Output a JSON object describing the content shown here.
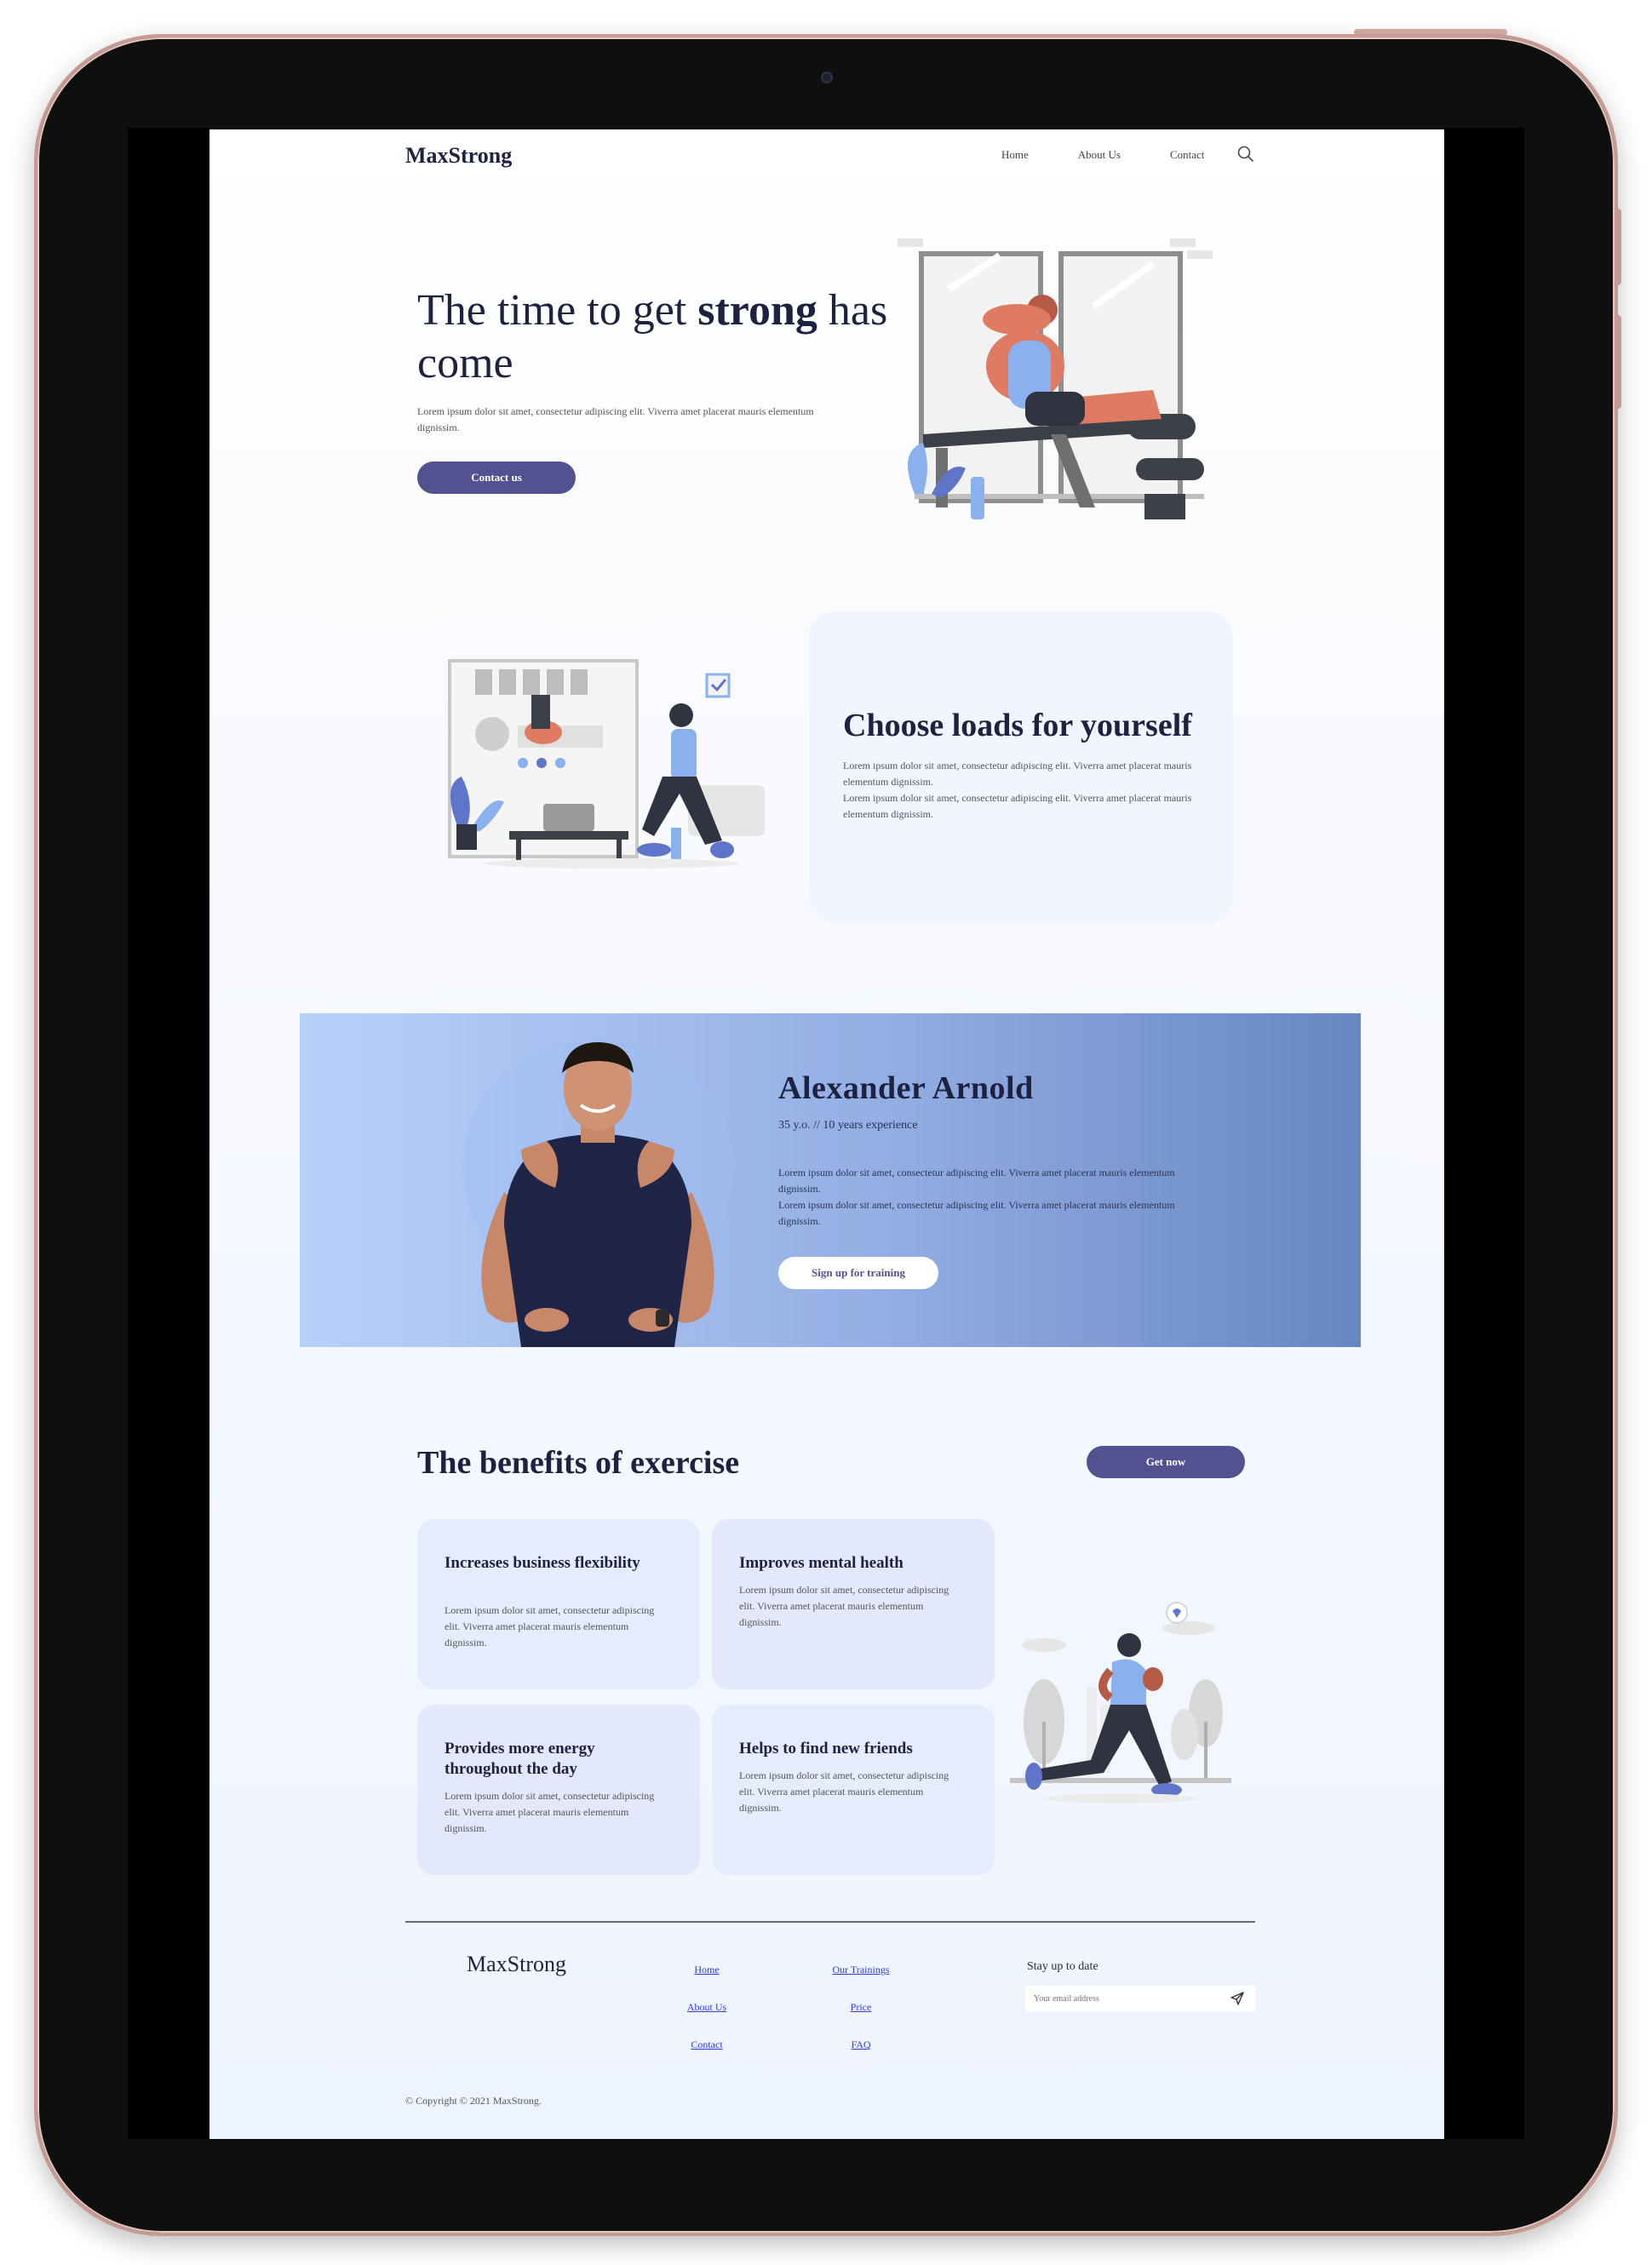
{
  "brand": {
    "name": "MaxStrong"
  },
  "nav": {
    "home": "Home",
    "about": "About Us",
    "contact": "Contact"
  },
  "hero": {
    "title_pre": "The time to get ",
    "title_bold": "strong",
    "title_post": " has come",
    "text": "Lorem ipsum dolor sit amet, consectetur adipiscing elit. Viverra amet placerat mauris elementum dignissim.",
    "button": "Contact us"
  },
  "loads": {
    "title_pre": "Choose loads ",
    "title_bold": "for yourself",
    "text1": "Lorem ipsum dolor sit amet, consectetur adipiscing elit. Viverra amet placerat mauris elementum dignissim.",
    "text2": "Lorem ipsum dolor sit amet, consectetur adipiscing elit. Viverra amet placerat mauris elementum dignissim."
  },
  "trainer": {
    "name": "Alexander Arnold",
    "sub": "35 y.o. // 10 years experience",
    "text1": "Lorem ipsum dolor sit amet, consectetur adipiscing elit. Viverra amet placerat mauris elementum dignissim.",
    "text2": "Lorem ipsum dolor sit amet, consectetur adipiscing elit. Viverra amet placerat mauris elementum dignissim.",
    "button": "Sign up for training"
  },
  "benefits": {
    "title_bold": "The benefits",
    "title_post": " of exercise",
    "button": "Get now",
    "cards": [
      {
        "title": "Increases business flexibility",
        "text": "Lorem ipsum dolor sit amet, consectetur adipiscing elit. Viverra amet placerat mauris elementum dignissim."
      },
      {
        "title": "Improves mental health",
        "text": "Lorem ipsum dolor sit amet, consectetur adipiscing elit. Viverra amet placerat mauris elementum dignissim."
      },
      {
        "title": "Provides more energy throughout the day",
        "text": "Lorem ipsum dolor sit amet, consectetur adipiscing elit. Viverra amet placerat mauris elementum dignissim."
      },
      {
        "title": "Helps to find new friends",
        "text": "Lorem ipsum dolor sit amet, consectetur adipiscing elit. Viverra amet placerat mauris elementum dignissim."
      }
    ]
  },
  "footer": {
    "logo": "MaxStrong",
    "links": {
      "home": "Home",
      "about": "About Us",
      "contact": "Contact",
      "trainings": "Our Trainings",
      "price": "Price",
      "faq": "FAQ"
    },
    "stay": "Stay up to date",
    "email_placeholder": "Your email address",
    "copyright": "© Copyright © 2021 MaxStrong."
  },
  "colors": {
    "accent": "#51528f",
    "banner_start": "#b8d1fb",
    "banner_end": "#6787c1",
    "card_blue": "#e3edfd",
    "card_lavender": "#e4e8fb"
  },
  "icons": {
    "search": "search-icon",
    "send": "send-icon"
  }
}
